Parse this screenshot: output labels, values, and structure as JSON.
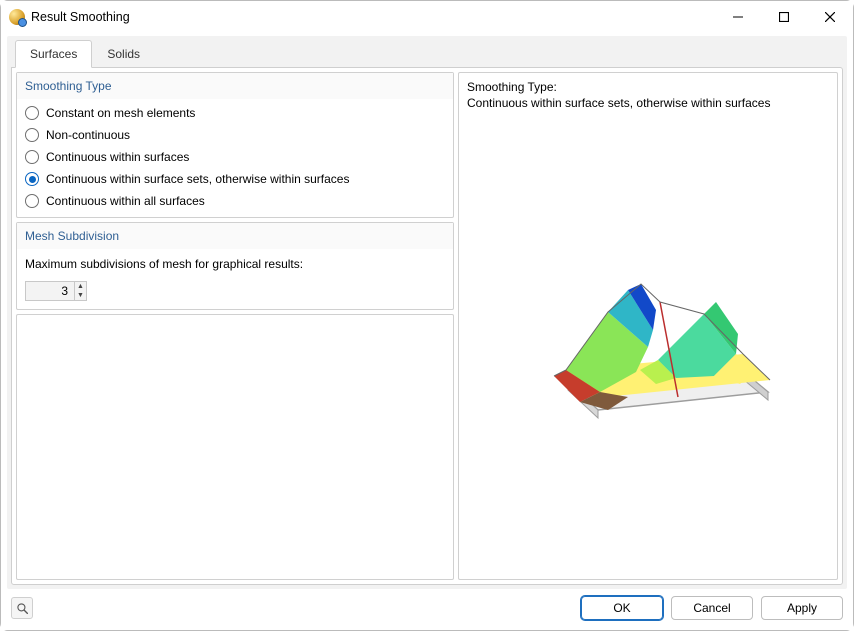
{
  "window": {
    "title": "Result Smoothing"
  },
  "tabs": {
    "surfaces": "Surfaces",
    "solids": "Solids"
  },
  "smoothing": {
    "header": "Smoothing Type",
    "options": [
      "Constant on mesh elements",
      "Non-continuous",
      "Continuous within surfaces",
      "Continuous within surface sets, otherwise within surfaces",
      "Continuous within all surfaces"
    ],
    "selected_index": 3
  },
  "subdivision": {
    "header": "Mesh Subdivision",
    "label": "Maximum subdivisions of mesh for graphical results:",
    "value": "3"
  },
  "preview": {
    "label": "Smoothing Type:",
    "desc": "Continuous within surface sets, otherwise within surfaces"
  },
  "buttons": {
    "ok": "OK",
    "cancel": "Cancel",
    "apply": "Apply"
  }
}
